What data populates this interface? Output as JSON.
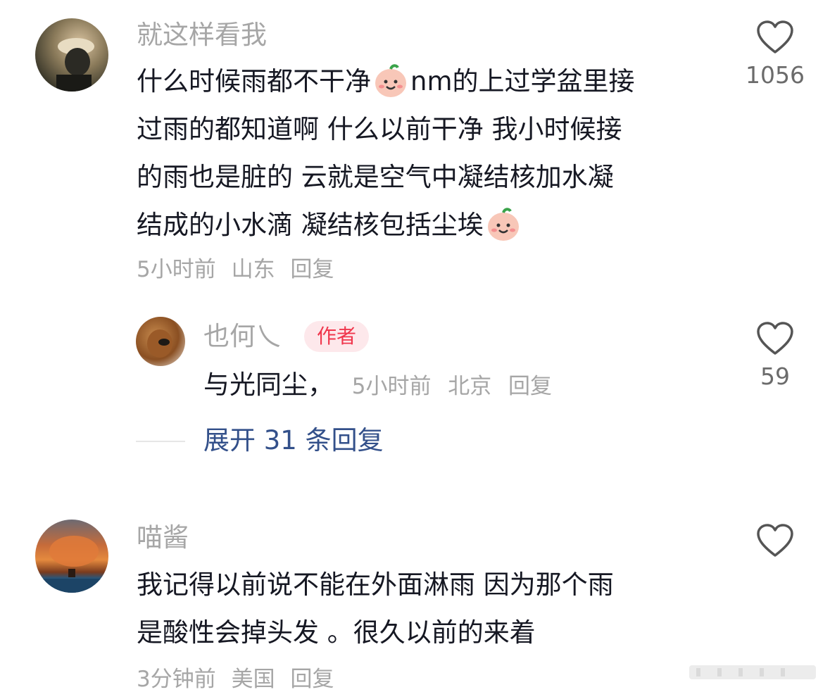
{
  "comments": [
    {
      "username": "就这样看我",
      "lines": [
        {
          "before": "什么时候雨都不干净",
          "emoji": "smile-emoji",
          "after": "nm的上过学盆里接"
        },
        {
          "before": "过雨的都知道啊 什么以前干净 我小时候接"
        },
        {
          "before": "的雨也是脏的 云就是空气中凝结核加水凝"
        },
        {
          "before": "结成的小水滴 凝结核包括尘埃",
          "emoji": "smile-emoji"
        }
      ],
      "time": "5小时前",
      "location": "山东",
      "reply_label": "回复",
      "likes": "1056"
    },
    {
      "username": "也何乀",
      "badge": "作者",
      "text": "与光同尘，",
      "time": "5小时前",
      "location": "北京",
      "reply_label": "回复",
      "likes": "59"
    },
    {
      "username": "喵酱",
      "lines": [
        {
          "before": "我记得以前说不能在外面淋雨  因为那个雨"
        },
        {
          "before": "是酸性会掉头发 。很久以前的来着"
        }
      ],
      "time": "3分钟前",
      "location": "美国",
      "reply_label": "回复",
      "likes": ""
    }
  ],
  "expand_replies": "展开 31 条回复",
  "colors": {
    "username": "#a6a6a6",
    "text": "#161823",
    "link": "#33508a",
    "badge_bg": "#fde8eb",
    "badge_text": "#f0364c"
  }
}
